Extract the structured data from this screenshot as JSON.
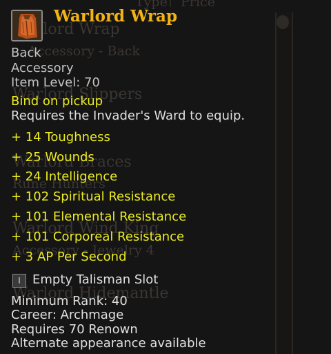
{
  "item": {
    "name": "Warlord Wrap",
    "icon": "cloak-icon",
    "slot": "Back",
    "type": "Accessory",
    "item_level": "Item Level: 70",
    "bind": "Bind on pickup",
    "requirement": "Requires the Invader's Ward to equip.",
    "stats": [
      "+ 14 Toughness",
      "+ 25 Wounds",
      "+ 24 Intelligence",
      "+ 102 Spiritual Resistance",
      "+ 101 Elemental Resistance",
      "+ 101 Corporeal Resistance",
      "+ 3 AP Per Second"
    ],
    "talisman": {
      "icon_glyph": "I",
      "label": "Empty Talisman Slot"
    },
    "minimum_rank": "Minimum Rank: 40",
    "career": "Career: Archmage",
    "renown": "Requires 70 Renown",
    "appearance": "Alternate appearance available"
  },
  "background_list": {
    "header_type": "Type",
    "header_price": "Price",
    "rows": [
      {
        "name": "Warlord Wrap",
        "sub": "Accessory - Back"
      },
      {
        "name": "Warlord Slippers",
        "sub": ""
      },
      {
        "name": "Warlord Braces",
        "sub": "Rune Hunters"
      },
      {
        "name": "Warlord Wind King",
        "sub": "Accessory - Jewelry 4"
      },
      {
        "name": "Warlord Hidemantle",
        "sub": ""
      }
    ]
  },
  "colors": {
    "item_name": "#f2b316",
    "bind_and_stats": "#ecec22",
    "text": "#e0e0e0"
  }
}
